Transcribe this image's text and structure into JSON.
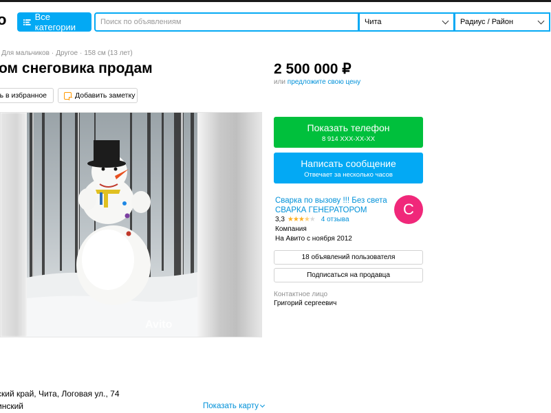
{
  "header": {
    "logo_fragment": "о",
    "categories_label": "Все категории",
    "search_placeholder": "Поиск по объявлениям",
    "city": "Чита",
    "radius": "Радиус / Район"
  },
  "breadcrumbs": [
    "Для мальчиков",
    "Другое",
    "158 см (13 лет)"
  ],
  "listing": {
    "title": "ом снеговика продам",
    "price": "2 500 000 ₽",
    "price_or": "или",
    "price_link": "предложите свою цену",
    "favorite_label": "ить в избранное",
    "note_label": "Добавить заметку",
    "watermark": "Avito"
  },
  "actions": {
    "phone_label": "Показать телефон",
    "phone_number": "8 914 XXX-XX-XX",
    "message_label": "Написать сообщение",
    "message_sub": "Отвечает за несколько часов"
  },
  "seller": {
    "name": "Сварка по вызову !!! Без света СВАРКА ГЕНЕРАТОРОМ",
    "avatar_letter": "С",
    "avatar_color": "#f0287a",
    "rating": "3,3",
    "rating_value": 3.3,
    "reviews": "4 отзыва",
    "type": "Компания",
    "since": "На Авито с ноября 2012",
    "listings_button": "18 объявлений пользователя",
    "subscribe_button": "Подписаться на продавца"
  },
  "contact": {
    "label": "Контактное лицо",
    "name": "Григорий сергеевич"
  },
  "address": {
    "line1": "ский край, Чита, Логовая ул., 74",
    "line2": "инский",
    "show_map": "Показать карту"
  },
  "colors": {
    "accent_blue": "#03a9f4",
    "green": "#00c03c",
    "link": "#0091d9",
    "star": "#ffb021"
  }
}
